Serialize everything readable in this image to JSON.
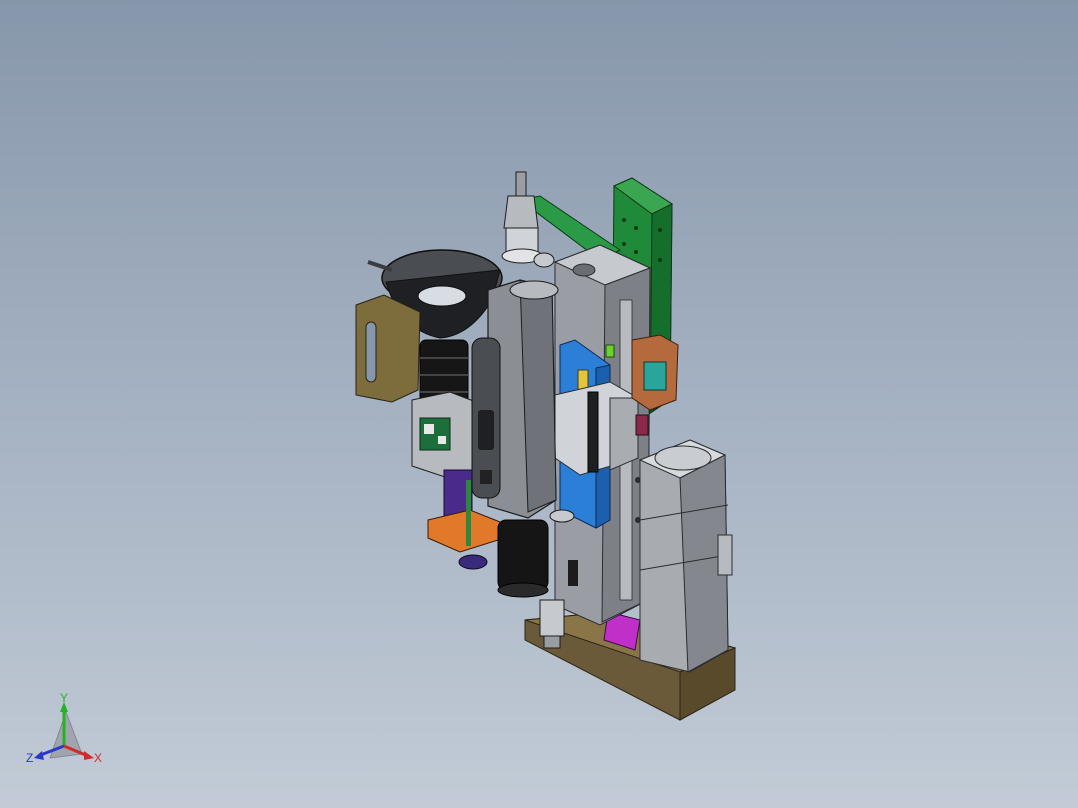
{
  "viewport": {
    "background_top": "#8797ab",
    "background_bottom": "#c2cbd6"
  },
  "model": {
    "colors": {
      "plate_green": "#1f8a3a",
      "frame_gray": "#9a9ea4",
      "frame_light": "#c6c9cd",
      "dark_gray": "#4a4d52",
      "black": "#161616",
      "base_brown": "#6a5a3a",
      "bracket_olive": "#7d6c3c",
      "rail_blue": "#2c7fd6",
      "magenta": "#c02fc8",
      "orange": "#e07a2a",
      "purple": "#4a2a8a",
      "yellow": "#e3c43a",
      "copper": "#b46a3c",
      "teal": "#2aa59c",
      "lime": "#6ad22a",
      "maroon": "#8a2a4a"
    }
  },
  "triad": {
    "y_label": "Y",
    "z_label": "Z",
    "x_label": "X",
    "colors": {
      "y": "#23b423",
      "z": "#2a39c8",
      "x": "#d22a2a"
    }
  }
}
